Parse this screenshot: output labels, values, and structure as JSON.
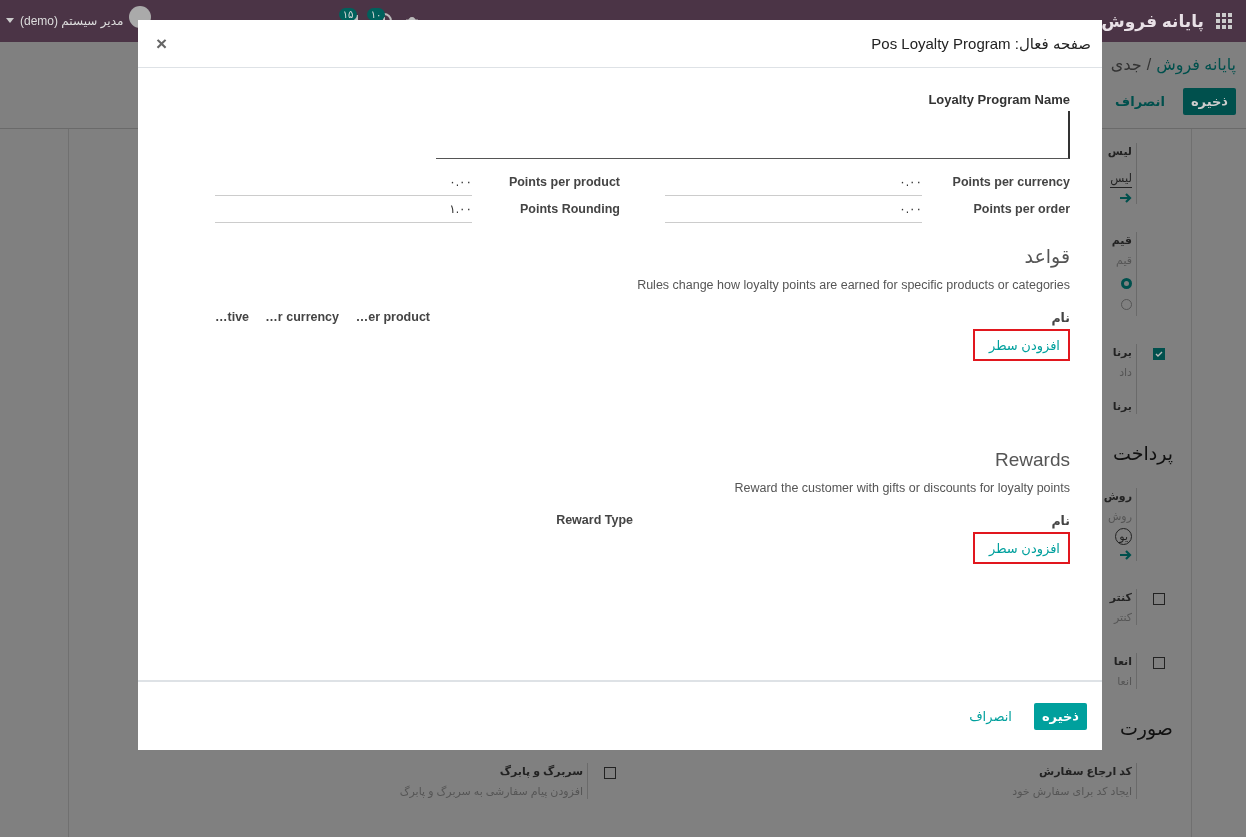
{
  "top_bar": {
    "app_name": "پایانه فروش",
    "user": "مدیر سیستم (demo)",
    "messages_badge": "۱۵",
    "activities_badge": "۱۰"
  },
  "backdrop": {
    "breadcrumb": {
      "parent": "پایانه فروش",
      "separator": "/",
      "current": "جدی"
    },
    "buttons": [
      {
        "label": "ذخیره",
        "kind": "primary"
      },
      {
        "label": "انصراف",
        "kind": "secondary"
      }
    ],
    "settings": [
      {
        "kind": "setting",
        "title": "لیس",
        "field": "لیس",
        "link": true
      },
      {
        "kind": "setting",
        "title": "قیم",
        "hint": "قیم",
        "radios": [
          {
            "selected": true
          },
          {
            "selected": false
          }
        ]
      },
      {
        "kind": "setting",
        "checked": true,
        "title": "برنا",
        "hint": "داد",
        "extra_title": "برنا"
      },
      {
        "kind": "heading",
        "text": "پرداخت"
      },
      {
        "kind": "setting",
        "title": "روش",
        "hint": "روش",
        "tag": "یو",
        "link": true
      },
      {
        "kind": "setting",
        "checked": false,
        "title": "کنتر",
        "hint": "کنتر"
      },
      {
        "kind": "setting",
        "checked": false,
        "title": "انعا",
        "hint": "انعا"
      },
      {
        "kind": "heading",
        "text": "صورت"
      },
      {
        "kind": "row",
        "settings": [
          {
            "title": "کد ارجاع سفارش",
            "hint": "ایجاد کد برای سفارش خود"
          },
          {
            "checked": false,
            "title": "سربرگ و پابرگ",
            "hint": "افزودن پیام سفارشی به سربرگ و پابرگ"
          }
        ]
      }
    ]
  },
  "dialog": {
    "title": "صفحه فعال: Pos Loyalty Program",
    "close": "×",
    "name_label": "Loyalty Program Name",
    "fields": [
      {
        "label": "Points per currency",
        "value": "۰.۰۰"
      },
      {
        "label": "Points per product",
        "value": "۰.۰۰"
      },
      {
        "label": "Points per order",
        "value": "۰.۰۰"
      },
      {
        "label": "Points Rounding",
        "value": "۱.۰۰"
      }
    ],
    "sections": [
      {
        "title": "قواعد",
        "description": "Rules change how loyalty points are earned for specific products or categories",
        "columns": [
          "نام",
          "…er product",
          "…r currency",
          "…tive"
        ],
        "add_line": "افزودن سطر",
        "highlighted": true
      },
      {
        "title": "Rewards",
        "description": "Reward the customer with gifts or discounts for loyalty points",
        "columns": [
          "نام",
          "Reward Type"
        ],
        "add_line": "افزودن سطر",
        "highlighted": true
      }
    ],
    "buttons": [
      {
        "label": "ذخیره",
        "kind": "primary"
      },
      {
        "label": "انصراف",
        "kind": "secondary"
      }
    ]
  }
}
